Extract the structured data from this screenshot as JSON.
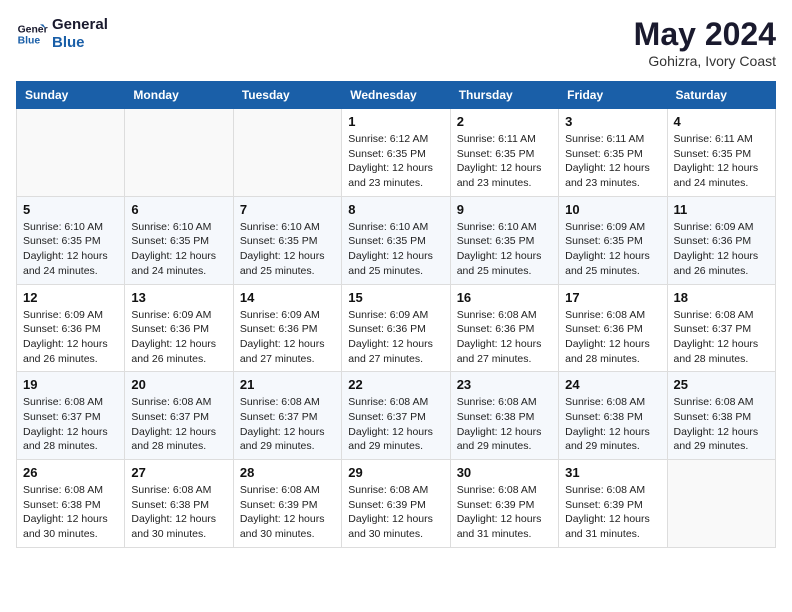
{
  "logo": {
    "line1": "General",
    "line2": "Blue"
  },
  "title": "May 2024",
  "location": "Gohizra, Ivory Coast",
  "weekdays": [
    "Sunday",
    "Monday",
    "Tuesday",
    "Wednesday",
    "Thursday",
    "Friday",
    "Saturday"
  ],
  "weeks": [
    [
      {
        "day": "",
        "sunrise": "",
        "sunset": "",
        "daylight": ""
      },
      {
        "day": "",
        "sunrise": "",
        "sunset": "",
        "daylight": ""
      },
      {
        "day": "",
        "sunrise": "",
        "sunset": "",
        "daylight": ""
      },
      {
        "day": "1",
        "sunrise": "Sunrise: 6:12 AM",
        "sunset": "Sunset: 6:35 PM",
        "daylight": "Daylight: 12 hours and 23 minutes."
      },
      {
        "day": "2",
        "sunrise": "Sunrise: 6:11 AM",
        "sunset": "Sunset: 6:35 PM",
        "daylight": "Daylight: 12 hours and 23 minutes."
      },
      {
        "day": "3",
        "sunrise": "Sunrise: 6:11 AM",
        "sunset": "Sunset: 6:35 PM",
        "daylight": "Daylight: 12 hours and 23 minutes."
      },
      {
        "day": "4",
        "sunrise": "Sunrise: 6:11 AM",
        "sunset": "Sunset: 6:35 PM",
        "daylight": "Daylight: 12 hours and 24 minutes."
      }
    ],
    [
      {
        "day": "5",
        "sunrise": "Sunrise: 6:10 AM",
        "sunset": "Sunset: 6:35 PM",
        "daylight": "Daylight: 12 hours and 24 minutes."
      },
      {
        "day": "6",
        "sunrise": "Sunrise: 6:10 AM",
        "sunset": "Sunset: 6:35 PM",
        "daylight": "Daylight: 12 hours and 24 minutes."
      },
      {
        "day": "7",
        "sunrise": "Sunrise: 6:10 AM",
        "sunset": "Sunset: 6:35 PM",
        "daylight": "Daylight: 12 hours and 25 minutes."
      },
      {
        "day": "8",
        "sunrise": "Sunrise: 6:10 AM",
        "sunset": "Sunset: 6:35 PM",
        "daylight": "Daylight: 12 hours and 25 minutes."
      },
      {
        "day": "9",
        "sunrise": "Sunrise: 6:10 AM",
        "sunset": "Sunset: 6:35 PM",
        "daylight": "Daylight: 12 hours and 25 minutes."
      },
      {
        "day": "10",
        "sunrise": "Sunrise: 6:09 AM",
        "sunset": "Sunset: 6:35 PM",
        "daylight": "Daylight: 12 hours and 25 minutes."
      },
      {
        "day": "11",
        "sunrise": "Sunrise: 6:09 AM",
        "sunset": "Sunset: 6:36 PM",
        "daylight": "Daylight: 12 hours and 26 minutes."
      }
    ],
    [
      {
        "day": "12",
        "sunrise": "Sunrise: 6:09 AM",
        "sunset": "Sunset: 6:36 PM",
        "daylight": "Daylight: 12 hours and 26 minutes."
      },
      {
        "day": "13",
        "sunrise": "Sunrise: 6:09 AM",
        "sunset": "Sunset: 6:36 PM",
        "daylight": "Daylight: 12 hours and 26 minutes."
      },
      {
        "day": "14",
        "sunrise": "Sunrise: 6:09 AM",
        "sunset": "Sunset: 6:36 PM",
        "daylight": "Daylight: 12 hours and 27 minutes."
      },
      {
        "day": "15",
        "sunrise": "Sunrise: 6:09 AM",
        "sunset": "Sunset: 6:36 PM",
        "daylight": "Daylight: 12 hours and 27 minutes."
      },
      {
        "day": "16",
        "sunrise": "Sunrise: 6:08 AM",
        "sunset": "Sunset: 6:36 PM",
        "daylight": "Daylight: 12 hours and 27 minutes."
      },
      {
        "day": "17",
        "sunrise": "Sunrise: 6:08 AM",
        "sunset": "Sunset: 6:36 PM",
        "daylight": "Daylight: 12 hours and 28 minutes."
      },
      {
        "day": "18",
        "sunrise": "Sunrise: 6:08 AM",
        "sunset": "Sunset: 6:37 PM",
        "daylight": "Daylight: 12 hours and 28 minutes."
      }
    ],
    [
      {
        "day": "19",
        "sunrise": "Sunrise: 6:08 AM",
        "sunset": "Sunset: 6:37 PM",
        "daylight": "Daylight: 12 hours and 28 minutes."
      },
      {
        "day": "20",
        "sunrise": "Sunrise: 6:08 AM",
        "sunset": "Sunset: 6:37 PM",
        "daylight": "Daylight: 12 hours and 28 minutes."
      },
      {
        "day": "21",
        "sunrise": "Sunrise: 6:08 AM",
        "sunset": "Sunset: 6:37 PM",
        "daylight": "Daylight: 12 hours and 29 minutes."
      },
      {
        "day": "22",
        "sunrise": "Sunrise: 6:08 AM",
        "sunset": "Sunset: 6:37 PM",
        "daylight": "Daylight: 12 hours and 29 minutes."
      },
      {
        "day": "23",
        "sunrise": "Sunrise: 6:08 AM",
        "sunset": "Sunset: 6:38 PM",
        "daylight": "Daylight: 12 hours and 29 minutes."
      },
      {
        "day": "24",
        "sunrise": "Sunrise: 6:08 AM",
        "sunset": "Sunset: 6:38 PM",
        "daylight": "Daylight: 12 hours and 29 minutes."
      },
      {
        "day": "25",
        "sunrise": "Sunrise: 6:08 AM",
        "sunset": "Sunset: 6:38 PM",
        "daylight": "Daylight: 12 hours and 29 minutes."
      }
    ],
    [
      {
        "day": "26",
        "sunrise": "Sunrise: 6:08 AM",
        "sunset": "Sunset: 6:38 PM",
        "daylight": "Daylight: 12 hours and 30 minutes."
      },
      {
        "day": "27",
        "sunrise": "Sunrise: 6:08 AM",
        "sunset": "Sunset: 6:38 PM",
        "daylight": "Daylight: 12 hours and 30 minutes."
      },
      {
        "day": "28",
        "sunrise": "Sunrise: 6:08 AM",
        "sunset": "Sunset: 6:39 PM",
        "daylight": "Daylight: 12 hours and 30 minutes."
      },
      {
        "day": "29",
        "sunrise": "Sunrise: 6:08 AM",
        "sunset": "Sunset: 6:39 PM",
        "daylight": "Daylight: 12 hours and 30 minutes."
      },
      {
        "day": "30",
        "sunrise": "Sunrise: 6:08 AM",
        "sunset": "Sunset: 6:39 PM",
        "daylight": "Daylight: 12 hours and 31 minutes."
      },
      {
        "day": "31",
        "sunrise": "Sunrise: 6:08 AM",
        "sunset": "Sunset: 6:39 PM",
        "daylight": "Daylight: 12 hours and 31 minutes."
      },
      {
        "day": "",
        "sunrise": "",
        "sunset": "",
        "daylight": ""
      }
    ]
  ]
}
